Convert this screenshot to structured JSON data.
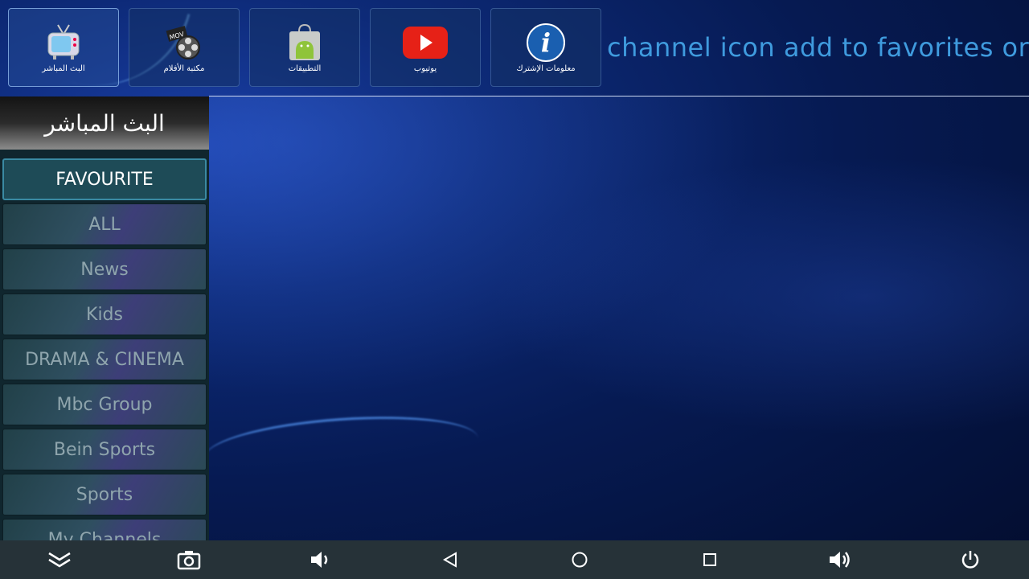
{
  "top_apps": [
    {
      "label": "البث المباشر",
      "icon": "live-tv-icon",
      "active": true
    },
    {
      "label": "مكتبة الأفلام",
      "icon": "film-reel-icon",
      "active": false
    },
    {
      "label": "التطبيقات",
      "icon": "android-bag-icon",
      "active": false
    },
    {
      "label": "يوتيوب",
      "icon": "youtube-icon",
      "active": false
    },
    {
      "label": "معلومات الإشترك",
      "icon": "info-icon",
      "active": false
    }
  ],
  "marquee_text": "channel icon add to favorites or r",
  "panel": {
    "title": "البث المباشر",
    "categories": [
      "FAVOURITE",
      "ALL",
      "News",
      "Kids",
      "DRAMA & CINEMA",
      "Mbc Group",
      "Bein Sports",
      "Sports",
      "My Channels"
    ],
    "selected_index": 0
  },
  "navbar": {
    "buttons": [
      "chevron-down-icon",
      "camera-icon",
      "volume-down-icon",
      "back-icon",
      "home-icon",
      "recents-icon",
      "volume-up-icon",
      "power-icon"
    ]
  },
  "colors": {
    "marquee": "#3f9bde",
    "navbar_bg": "#263238",
    "selected_border": "#3a8aa3"
  }
}
